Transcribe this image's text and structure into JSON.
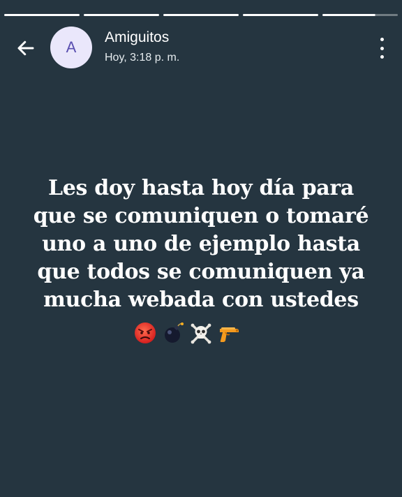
{
  "story": {
    "progress_segments": [
      {
        "state": "complete"
      },
      {
        "state": "complete"
      },
      {
        "state": "complete"
      },
      {
        "state": "complete"
      },
      {
        "state": "in_progress",
        "fraction": 0.7
      }
    ]
  },
  "header": {
    "avatar_initial": "A",
    "contact_name": "Amiguitos",
    "timestamp": "Hoy, 3:18 p. m.",
    "back_icon": "arrow-left-icon",
    "more_icon": "more-vertical-icon"
  },
  "message": {
    "lines": [
      "Les doy hasta hoy día para",
      "que se comuniquen o tomaré",
      "uno a uno de ejemplo hasta",
      "que todos se comuniquen ya",
      "mucha webada con ustedes"
    ],
    "emojis": [
      "angry-face-emoji",
      "bomb-emoji",
      "skull-crossbones-emoji",
      "pistol-emoji"
    ]
  },
  "colors": {
    "background": "#253540",
    "text": "#ffffff",
    "avatar_bg": "#eae7fb",
    "avatar_fg": "#5a4fb0"
  }
}
